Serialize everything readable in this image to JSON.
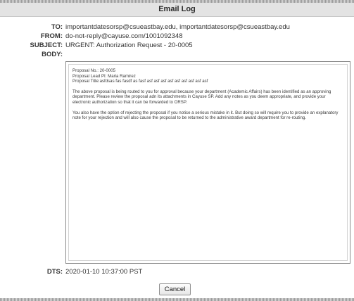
{
  "dialog": {
    "title": "Email Log"
  },
  "fields": {
    "to_label": "TO:",
    "to_value": "importantdatesorsp@csueastbay.edu, importantdatesorsp@csueastbay.edu",
    "from_label": "FROM:",
    "from_value": "do-not-reply@cayuse.com/1001092348",
    "subject_label": "SUBJECT:",
    "subject_value": "URGENT: Authorization Request - 20-0005",
    "body_label": "BODY:",
    "dts_label": "DTS:",
    "dts_value": "2020-01-10 10:37:00 PST"
  },
  "body": {
    "line1": "Proposal No.: 20-0005",
    "line2": "Proposal Lead PI: Maria Ramirez",
    "line3": "Proposal Title:asfdsas fas fasdf as fasf asf asf asf asf asf asf asf asf asf",
    "para1": "The above proposal is being routed to you for approval because your department (Academic Affairs) has been identified as an approving department. Please review the proposal adn its attachments in Cayuse SP.  Add any notes as you deem appropriate, and provide your electronic authorization so that it can be forwarded to ORSP.",
    "para2": "You also have the option of rejecting the proposal if you notice a serious mistake in it. But doing so will require you to provide an explanatory note for your rejection and will also cause the proposal to be returned to the administrative award department for re-routing."
  },
  "actions": {
    "cancel_label": "Cancel"
  }
}
